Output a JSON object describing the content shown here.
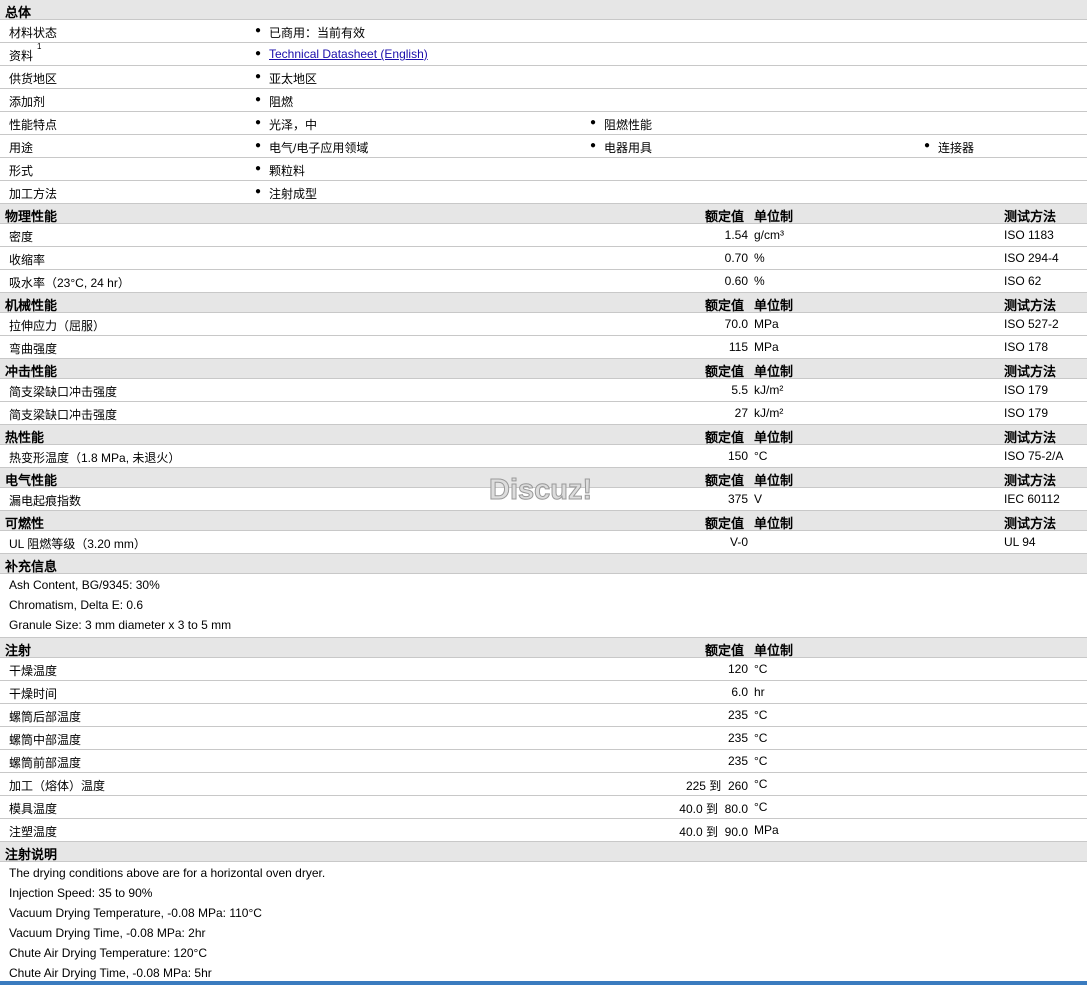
{
  "general": {
    "title": "总体",
    "rows": [
      {
        "label": "材料状态",
        "items": [
          "已商用：当前有效"
        ]
      },
      {
        "label": "资料",
        "sup": "1",
        "items": [
          "Technical Datasheet (English)"
        ],
        "link": true
      },
      {
        "label": "供货地区",
        "items": [
          "亚太地区"
        ]
      },
      {
        "label": "添加剂",
        "items": [
          "阻燃"
        ]
      },
      {
        "label": "性能特点",
        "items": [
          "光泽，中",
          "阻燃性能"
        ]
      },
      {
        "label": "用途",
        "items": [
          "电气/电子应用领域",
          "电器用具",
          "连接器"
        ]
      },
      {
        "label": "形式",
        "items": [
          "颗粒料"
        ]
      },
      {
        "label": "加工方法",
        "items": [
          "注射成型"
        ]
      }
    ]
  },
  "headers": {
    "value": "额定值",
    "unit": "单位制",
    "method": "测试方法"
  },
  "sections": [
    {
      "title": "物理性能",
      "method": true,
      "rows": [
        [
          "密度",
          "1.54",
          "g/cm³",
          "ISO 1183"
        ],
        [
          "收缩率",
          "0.70",
          "%",
          "ISO 294-4"
        ],
        [
          "吸水率（23°C, 24 hr）",
          "0.60",
          "%",
          "ISO 62"
        ]
      ]
    },
    {
      "title": "机械性能",
      "method": true,
      "rows": [
        [
          "拉伸应力（屈服）",
          "70.0",
          "MPa",
          "ISO 527-2"
        ],
        [
          "弯曲强度",
          "115",
          "MPa",
          "ISO 178"
        ]
      ]
    },
    {
      "title": "冲击性能",
      "method": true,
      "rows": [
        [
          "简支梁缺口冲击强度",
          "5.5",
          "kJ/m²",
          "ISO 179"
        ],
        [
          "简支梁缺口冲击强度",
          "27",
          "kJ/m²",
          "ISO 179"
        ]
      ]
    },
    {
      "title": "热性能",
      "method": true,
      "rows": [
        [
          "热变形温度（1.8 MPa, 未退火）",
          "150",
          "°C",
          "ISO 75-2/A"
        ]
      ]
    },
    {
      "title": "电气性能",
      "method": true,
      "rows": [
        [
          "漏电起痕指数",
          "375",
          "V",
          "IEC 60112"
        ]
      ]
    },
    {
      "title": "可燃性",
      "method": true,
      "rows": [
        [
          "UL 阻燃等级（3.20 mm）",
          "V-0",
          "",
          "UL 94"
        ]
      ]
    },
    {
      "title": "补充信息",
      "notes": [
        "Ash Content, BG/9345: 30%",
        "Chromatism, Delta E: 0.6",
        "Granule Size: 3 mm diameter x 3 to 5 mm"
      ]
    },
    {
      "title": "注射",
      "method": false,
      "rows": [
        [
          "干燥温度",
          "120",
          "°C",
          ""
        ],
        [
          "干燥时间",
          "6.0",
          "hr",
          ""
        ],
        [
          "螺筒后部温度",
          "235",
          "°C",
          ""
        ],
        [
          "螺筒中部温度",
          "235",
          "°C",
          ""
        ],
        [
          "螺筒前部温度",
          "235",
          "°C",
          ""
        ],
        [
          "加工（熔体）温度",
          "225 到  260",
          "°C",
          ""
        ],
        [
          "模具温度",
          "40.0 到  80.0",
          "°C",
          ""
        ],
        [
          "注塑温度",
          "40.0 到  90.0",
          "MPa",
          ""
        ]
      ]
    },
    {
      "title": "注射说明",
      "notes": [
        "The drying conditions above are for a horizontal oven dryer.",
        "Injection Speed: 35 to 90%",
        "Vacuum Drying Temperature, -0.08 MPa: 110°C",
        "Vacuum Drying Time, -0.08 MPa: 2hr",
        "Chute Air Drying Temperature: 120°C",
        "Chute Air Drying Time, -0.08 MPa: 5hr"
      ]
    }
  ],
  "watermark": "Discuz!"
}
